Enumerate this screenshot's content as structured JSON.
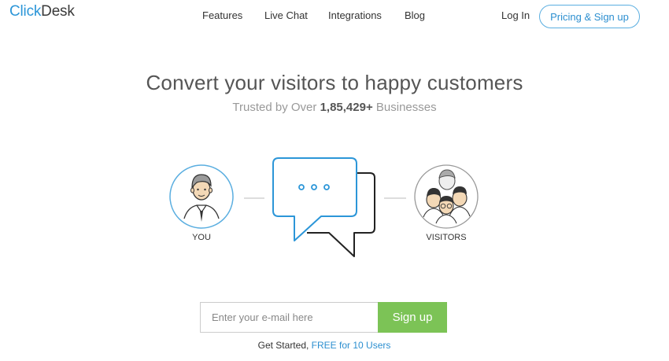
{
  "brand": {
    "part1": "Click",
    "part2": "Desk"
  },
  "nav": {
    "features": "Features",
    "live_chat": "Live Chat",
    "integrations": "Integrations",
    "blog": "Blog",
    "login": "Log In",
    "pricing": "Pricing & Sign up"
  },
  "hero": {
    "title": "Convert your visitors to happy customers",
    "subtitle_prefix": "Trusted by Over ",
    "subtitle_count": "1,85,429+",
    "subtitle_suffix": " Businesses"
  },
  "illustration": {
    "you_label": "YOU",
    "visitors_label": "VISITORS"
  },
  "signup": {
    "email_placeholder": "Enter your e-mail here",
    "button_label": "Sign up",
    "caption_prefix": "Get Started, ",
    "caption_free": "FREE for 10 Users"
  },
  "colors": {
    "brand_blue": "#2c96d8",
    "signup_green": "#7cc356",
    "text_dark": "#333333"
  }
}
